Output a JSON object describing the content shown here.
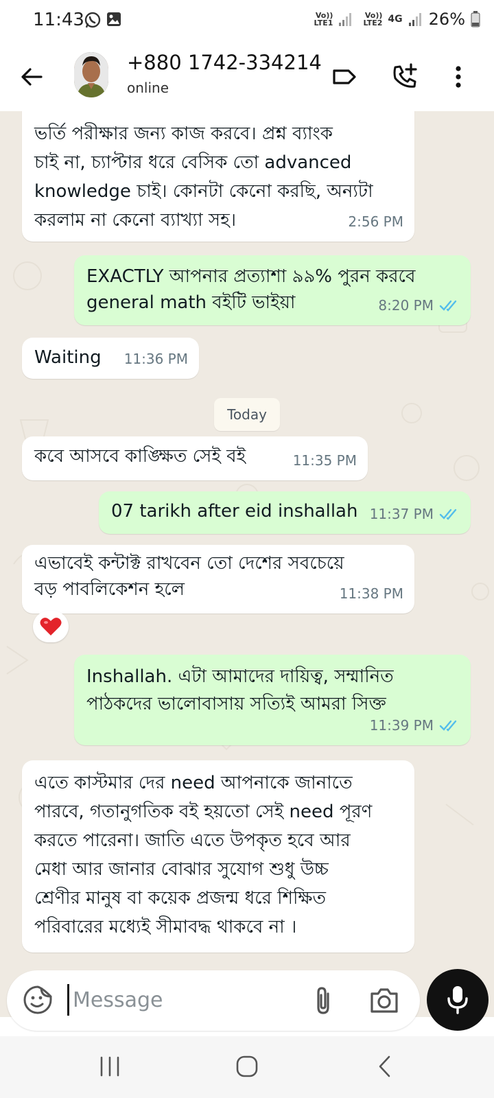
{
  "status_bar": {
    "time": "11:43",
    "sim1": "Vo)) LTE1",
    "sim2": "Vo)) LTE2",
    "network": "4G",
    "battery": "26%",
    "icons": [
      "whatsapp-icon",
      "gallery-icon",
      "signal-icon",
      "battery-icon"
    ]
  },
  "header": {
    "contact_name": "+880 1742-334214",
    "contact_status": "online",
    "icons": [
      "back-arrow-icon",
      "avatar",
      "label-icon",
      "add-call-icon",
      "more-vert-icon"
    ]
  },
  "messages": [
    {
      "direction": "in",
      "lines": [
        "ভর্তি পরীক্ষার জন্য কাজ করবে। প্রশ্ন ব্যাংক",
        "চাই না, চ্যাপ্টার ধরে বেসিক তো advanced",
        "knowledge চাই। কোনটা কেনো করছি, অন্যটা",
        "করলাম না কেনো ব্যাখ্যা সহ।"
      ],
      "time": "2:56 PM"
    },
    {
      "direction": "out",
      "lines": [
        "EXACTLY আপনার প্রত্যাশা ৯৯% পুরন করবে",
        "general math বইটি ভাইয়া"
      ],
      "time": "8:20 PM",
      "status": "read"
    },
    {
      "direction": "in",
      "lines": [
        "Waiting"
      ],
      "time": "11:36 PM"
    },
    {
      "direction": "in",
      "lines": [
        "কবে আসবে কাঙ্ক্ষিত সেই বই"
      ],
      "time": "11:35 PM"
    },
    {
      "direction": "out",
      "lines": [
        "07 tarikh after eid inshallah"
      ],
      "time": "11:37 PM",
      "status": "read"
    },
    {
      "direction": "in",
      "lines": [
        "এভাবেই কন্টাক্ট রাখবেন তো দেশের সবচেয়ে",
        "বড় পাবলিকেশন হলে"
      ],
      "time": "11:38 PM",
      "reaction": "❤️"
    },
    {
      "direction": "out",
      "lines": [
        "Inshallah.  এটা আমাদের দায়িত্ব, সম্মানিত",
        "পাঠকদের ভালোবাসায় সত্যিই আমরা সিক্ত"
      ],
      "time": "11:39 PM",
      "status": "read"
    },
    {
      "direction": "in",
      "lines": [
        "এতে কাস্টমার দের need আপনাকে জানাতে",
        "পারবে, গতানুগতিক বই হয়তো সেই need পূরণ",
        "করতে পারেনা। জাতি এতে উপকৃত হবে আর",
        "মেধা আর জানার বোঝার সুযোগ শুধু উচ্চ",
        "শ্রেণীর মানুষ বা কয়েক প্রজন্ম ধরে শিক্ষিত",
        "পরিবারের মধ্যেই সীমাবদ্ধ থাকবে না ।"
      ]
    }
  ],
  "date_divider": "Today",
  "input": {
    "placeholder": "Message",
    "value": "",
    "icons": [
      "sticker-icon",
      "attach-icon",
      "camera-icon",
      "mic-icon"
    ]
  },
  "nav_bar": {
    "icons": [
      "recents-icon",
      "home-icon",
      "back-icon"
    ]
  },
  "colors": {
    "chat_background": "#efeae2",
    "incoming_bubble": "#ffffff",
    "outgoing_bubble": "#d9fdd3",
    "read_ticks": "#53bdeb",
    "mic_button": "#111111"
  }
}
